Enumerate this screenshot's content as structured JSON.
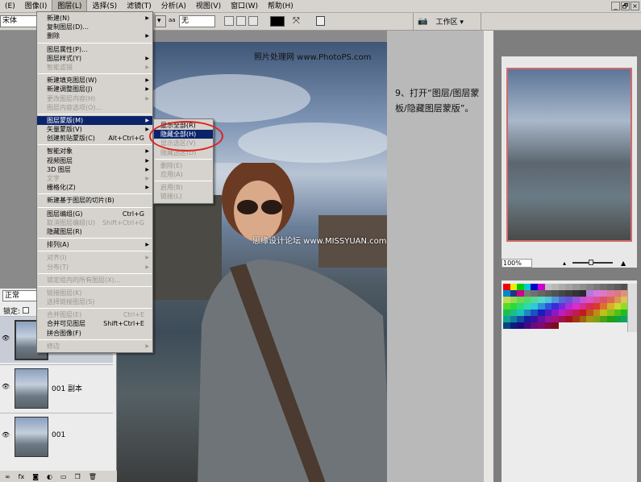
{
  "menubar": {
    "items": [
      "(E)",
      "图像(I)",
      "图层(L)",
      "选择(S)",
      "滤镜(T)",
      "分析(A)",
      "视图(V)",
      "窗口(W)",
      "帮助(H)"
    ],
    "window_buttons": [
      "_",
      "🗗",
      "×"
    ]
  },
  "toolbar": {
    "font": "宋体",
    "aa_label": "aa",
    "aa_value": "无",
    "workspace": "工作区 ▾"
  },
  "layer_menu": [
    {
      "label": "新建(N)",
      "arrow": true
    },
    {
      "label": "复制图层(D)..."
    },
    {
      "label": "删除",
      "arrow": true
    },
    {
      "sep": true
    },
    {
      "label": "图层属性(P)..."
    },
    {
      "label": "图层样式(Y)",
      "arrow": true
    },
    {
      "label": "智能滤镜",
      "disabled": true,
      "arrow": true
    },
    {
      "sep": true
    },
    {
      "label": "新建填充图层(W)",
      "arrow": true
    },
    {
      "label": "新建调整图层(J)",
      "arrow": true
    },
    {
      "label": "更改图层内容(H)",
      "disabled": true,
      "arrow": true
    },
    {
      "label": "图层内容选项(O)...",
      "disabled": true
    },
    {
      "sep": true
    },
    {
      "label": "图层蒙版(M)",
      "highlight": true,
      "arrow": true
    },
    {
      "label": "矢量蒙版(V)",
      "arrow": true
    },
    {
      "label": "创建剪贴蒙版(C)",
      "shortcut": "Alt+Ctrl+G"
    },
    {
      "sep": true
    },
    {
      "label": "智能对象",
      "arrow": true
    },
    {
      "label": "视频图层",
      "arrow": true
    },
    {
      "label": "3D 图层",
      "arrow": true
    },
    {
      "label": "文字",
      "disabled": true,
      "arrow": true
    },
    {
      "label": "栅格化(Z)",
      "arrow": true
    },
    {
      "sep": true
    },
    {
      "label": "新建基于图层的切片(B)"
    },
    {
      "sep": true
    },
    {
      "label": "图层编组(G)",
      "shortcut": "Ctrl+G"
    },
    {
      "label": "取消图层编组(U)",
      "shortcut": "Shift+Ctrl+G",
      "disabled": true
    },
    {
      "label": "隐藏图层(R)"
    },
    {
      "sep": true
    },
    {
      "label": "排列(A)",
      "arrow": true
    },
    {
      "sep": true
    },
    {
      "label": "对齐(I)",
      "disabled": true,
      "arrow": true
    },
    {
      "label": "分布(T)",
      "disabled": true,
      "arrow": true
    },
    {
      "sep": true
    },
    {
      "label": "锁定组内的所有图层(X)...",
      "disabled": true
    },
    {
      "sep": true
    },
    {
      "label": "链接图层(K)",
      "disabled": true
    },
    {
      "label": "选择链接图层(S)",
      "disabled": true
    },
    {
      "sep": true
    },
    {
      "label": "合并图层(E)",
      "shortcut": "Ctrl+E",
      "disabled": true
    },
    {
      "label": "合并可见图层",
      "shortcut": "Shift+Ctrl+E"
    },
    {
      "label": "拼合图像(F)"
    },
    {
      "sep": true
    },
    {
      "label": "修边",
      "disabled": true,
      "arrow": true
    }
  ],
  "mask_submenu": [
    {
      "label": "显示全部(R)"
    },
    {
      "label": "隐藏全部(H)",
      "highlight": true
    },
    {
      "label": "显示选区(V)",
      "disabled": true
    },
    {
      "label": "隐藏选区(D)",
      "disabled": true
    },
    {
      "sep": true
    },
    {
      "label": "删除(E)",
      "disabled": true
    },
    {
      "label": "应用(A)",
      "disabled": true
    },
    {
      "sep": true
    },
    {
      "label": "启用(B)",
      "disabled": true
    },
    {
      "label": "链接(L)",
      "disabled": true
    }
  ],
  "canvas": {
    "watermark_top": "照片处理网 www.PhotoPS.com",
    "watermark_mid": "思缘设计论坛 www.MISSYUAN.com"
  },
  "instruction": "9、打开“图层/图层蒙板/隐藏图层蒙版”。",
  "navigator": {
    "zoom": "100%"
  },
  "layers": {
    "blend_mode": "正常",
    "lock_label": "锁定:",
    "items": [
      {
        "name": ""
      },
      {
        "name": "001 副本"
      },
      {
        "name": "001"
      }
    ]
  },
  "colors": {
    "highlight": "#0a246a",
    "ring": "#d22222"
  }
}
